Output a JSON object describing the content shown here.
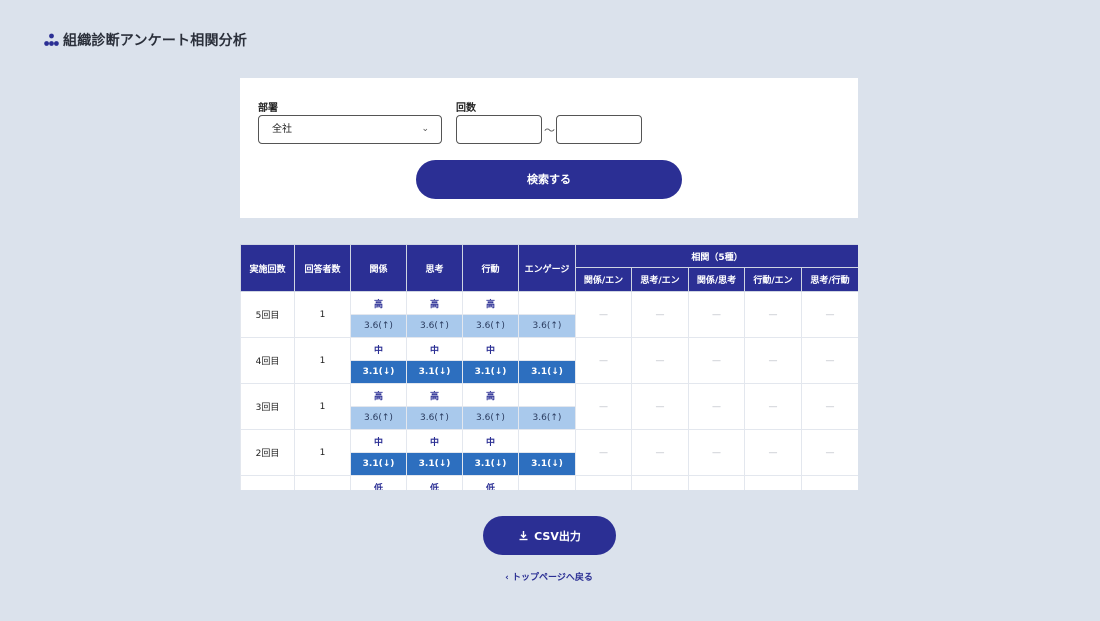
{
  "header": {
    "title": "組織診断アンケート相関分析",
    "icon": "org-chart-icon"
  },
  "search": {
    "department_label": "部署",
    "department_value": "全社",
    "round_label": "回数",
    "round_from": "",
    "round_to": "",
    "separator": "〜",
    "button": "検索する"
  },
  "table": {
    "headers": {
      "round": "実施回数",
      "respondents": "回答者数",
      "relation": "関係",
      "thinking": "思考",
      "action": "行動",
      "engagement": "エンゲージ",
      "correlation": "相関（5種）",
      "correlation_cols": [
        "関係/エン",
        "思考/エン",
        "関係/思考",
        "行動/エン",
        "思考/行動"
      ]
    },
    "rows": [
      {
        "round": "5回目",
        "respondents": "1",
        "levels": [
          "高",
          "高",
          "高",
          ""
        ],
        "scores": [
          "3.6(↑)",
          "3.6(↑)",
          "3.6(↑)",
          "3.6(↑)"
        ],
        "trend": "up",
        "correlations": [
          "—",
          "—",
          "—",
          "—",
          "—"
        ]
      },
      {
        "round": "4回目",
        "respondents": "1",
        "levels": [
          "中",
          "中",
          "中",
          ""
        ],
        "scores": [
          "3.1(↓)",
          "3.1(↓)",
          "3.1(↓)",
          "3.1(↓)"
        ],
        "trend": "down",
        "correlations": [
          "—",
          "—",
          "—",
          "—",
          "—"
        ]
      },
      {
        "round": "3回目",
        "respondents": "1",
        "levels": [
          "高",
          "高",
          "高",
          ""
        ],
        "scores": [
          "3.6(↑)",
          "3.6(↑)",
          "3.6(↑)",
          "3.6(↑)"
        ],
        "trend": "up",
        "correlations": [
          "—",
          "—",
          "—",
          "—",
          "—"
        ]
      },
      {
        "round": "2回目",
        "respondents": "1",
        "levels": [
          "中",
          "中",
          "中",
          ""
        ],
        "scores": [
          "3.1(↓)",
          "3.1(↓)",
          "3.1(↓)",
          "3.1(↓)"
        ],
        "trend": "down",
        "correlations": [
          "—",
          "—",
          "—",
          "—",
          "—"
        ]
      },
      {
        "round": "",
        "respondents": "",
        "levels": [
          "低",
          "低",
          "低",
          ""
        ],
        "scores": [
          "",
          "",
          "",
          ""
        ],
        "trend": "none",
        "correlations": [
          "",
          "",
          "",
          "",
          ""
        ]
      }
    ]
  },
  "actions": {
    "csv_button": "CSV出力",
    "csv_icon": "download-icon",
    "back_link": "‹ トップページへ戻る"
  },
  "colors": {
    "primary": "#2b2f94",
    "score_up": "#a9c9ec",
    "score_down": "#2d6fbf",
    "background": "#dbe2ec"
  }
}
